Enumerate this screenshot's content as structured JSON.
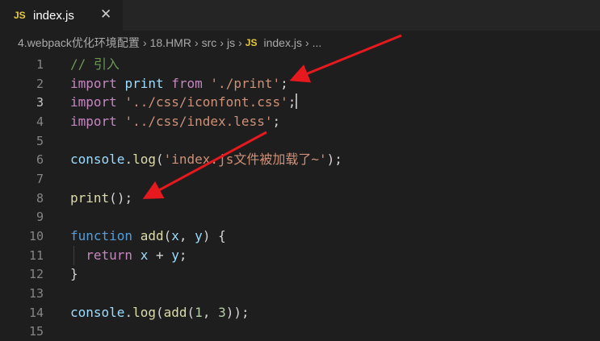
{
  "tab": {
    "icon_text": "JS",
    "filename": "index.js",
    "close_icon": "close-icon"
  },
  "breadcrumb": {
    "segments": [
      "4.webpack优化环境配置",
      "18.HMR",
      "src",
      "js"
    ],
    "file_icon_text": "JS",
    "file": "index.js",
    "more": "..."
  },
  "editor": {
    "active_line": 3,
    "lines": [
      {
        "n": "1",
        "c": "// 引入"
      },
      {
        "n": "2",
        "c": "import print from './print';"
      },
      {
        "n": "3",
        "c": "import '../css/iconfont.css';"
      },
      {
        "n": "4",
        "c": "import '../css/index.less';"
      },
      {
        "n": "5",
        "c": ""
      },
      {
        "n": "6",
        "c": "console.log('index.js文件被加载了~');"
      },
      {
        "n": "7",
        "c": ""
      },
      {
        "n": "8",
        "c": "print();"
      },
      {
        "n": "9",
        "c": ""
      },
      {
        "n": "10",
        "c": "function add(x, y) {"
      },
      {
        "n": "11",
        "c": "  return x + y;"
      },
      {
        "n": "12",
        "c": "}"
      },
      {
        "n": "13",
        "c": ""
      },
      {
        "n": "14",
        "c": "console.log(add(1, 3));"
      },
      {
        "n": "15",
        "c": ""
      }
    ]
  },
  "annotation": {
    "arrow_color": "#e5191e",
    "arrow_count": 2
  }
}
